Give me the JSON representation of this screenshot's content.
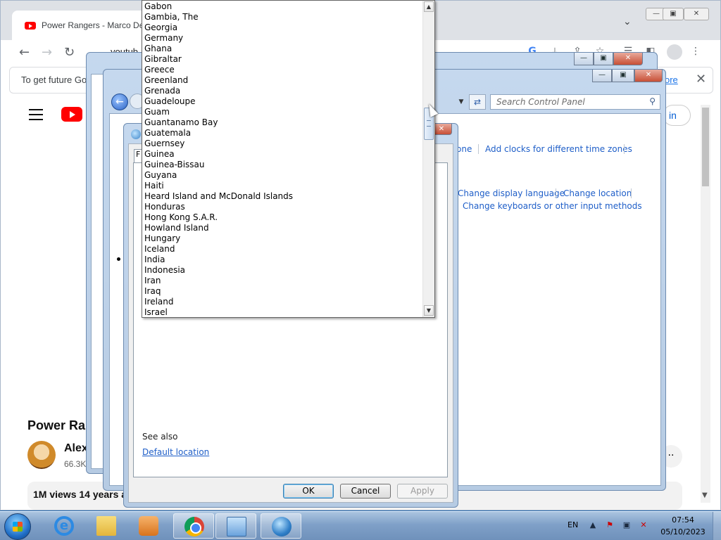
{
  "browser": {
    "tab_title": "Power Rangers - Marco Des",
    "url_fragment": "youtub",
    "infobar_text": "To get future Go",
    "infobar_link": "ore",
    "signin_label": "in"
  },
  "video": {
    "title": "Power Ran",
    "channel_name": "Alex",
    "subscribers": "66.3K",
    "views": "1M views  14 years a"
  },
  "control_panel": {
    "search_placeholder": "Search Control Panel",
    "links": {
      "time_zone_tail": "one",
      "add_clocks": "Add clocks for different time zones",
      "display_language": "Change display language",
      "location": "Change location",
      "keyboards": "Change keyboards or other input methods"
    }
  },
  "region_dialog": {
    "tab_stub": "F",
    "see_also": "See also",
    "default_location": "Default location",
    "buttons": {
      "ok": "OK",
      "cancel": "Cancel",
      "apply": "Apply"
    }
  },
  "country_list": [
    "Gabon",
    "Gambia, The",
    "Georgia",
    "Germany",
    "Ghana",
    "Gibraltar",
    "Greece",
    "Greenland",
    "Grenada",
    "Guadeloupe",
    "Guam",
    "Guantanamo Bay",
    "Guatemala",
    "Guernsey",
    "Guinea",
    "Guinea-Bissau",
    "Guyana",
    "Haiti",
    "Heard Island and McDonald Islands",
    "Honduras",
    "Hong Kong S.A.R.",
    "Howland Island",
    "Hungary",
    "Iceland",
    "India",
    "Indonesia",
    "Iran",
    "Iraq",
    "Ireland",
    "Israel"
  ],
  "taskbar": {
    "language": "EN",
    "time": "07:54",
    "date": "05/10/2023",
    "pinned": [
      "ie-icon",
      "explorer-icon",
      "media-center-icon",
      "chrome-icon",
      "control-panel-icon",
      "region-globe-icon"
    ]
  },
  "colors": {
    "link_blue": "#1e5ec8",
    "youtube_red": "#ff0000",
    "taskbar": "#7fa0c8"
  }
}
